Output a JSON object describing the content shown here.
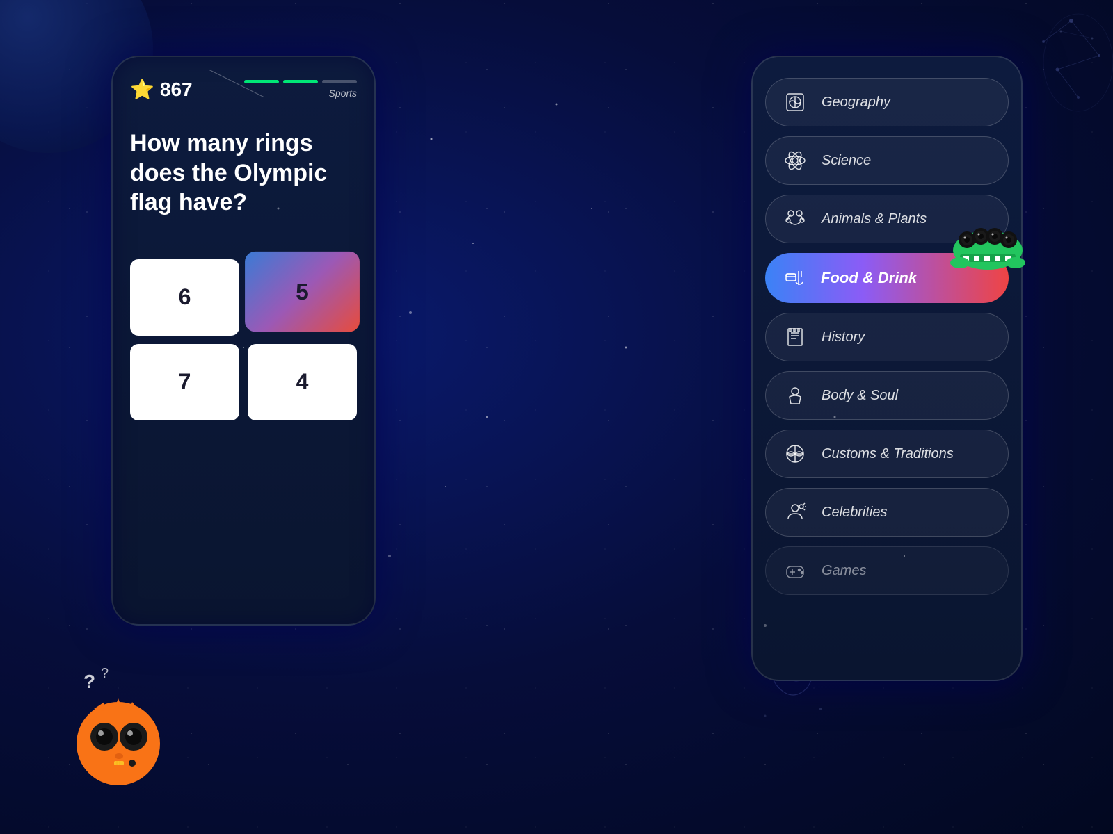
{
  "background": {
    "color_start": "#0a1a6e",
    "color_end": "#020820"
  },
  "left_phone": {
    "score": "867",
    "star_icon": "⭐",
    "progress": {
      "bar1": "active",
      "bar2": "active",
      "bar3": "inactive",
      "category": "Sports"
    },
    "question": "How many rings does the Olympic flag have?",
    "answers": [
      {
        "value": "6",
        "selected": false
      },
      {
        "value": "5",
        "selected": true
      },
      {
        "value": "7",
        "selected": false
      },
      {
        "value": "4",
        "selected": false
      }
    ]
  },
  "right_phone": {
    "categories": [
      {
        "name": "Geography",
        "icon": "map",
        "active": false
      },
      {
        "name": "Science",
        "icon": "atom",
        "active": false
      },
      {
        "name": "Animals & Plants",
        "icon": "paw",
        "active": false
      },
      {
        "name": "Food & Drink",
        "icon": "food",
        "active": true
      },
      {
        "name": "History",
        "icon": "history",
        "active": false
      },
      {
        "name": "Body & Soul",
        "icon": "body",
        "active": false
      },
      {
        "name": "Customs & Traditions",
        "icon": "globe",
        "active": false
      },
      {
        "name": "Celebrities",
        "icon": "person",
        "active": false
      },
      {
        "name": "Games",
        "icon": "gamepad",
        "active": false
      }
    ]
  }
}
